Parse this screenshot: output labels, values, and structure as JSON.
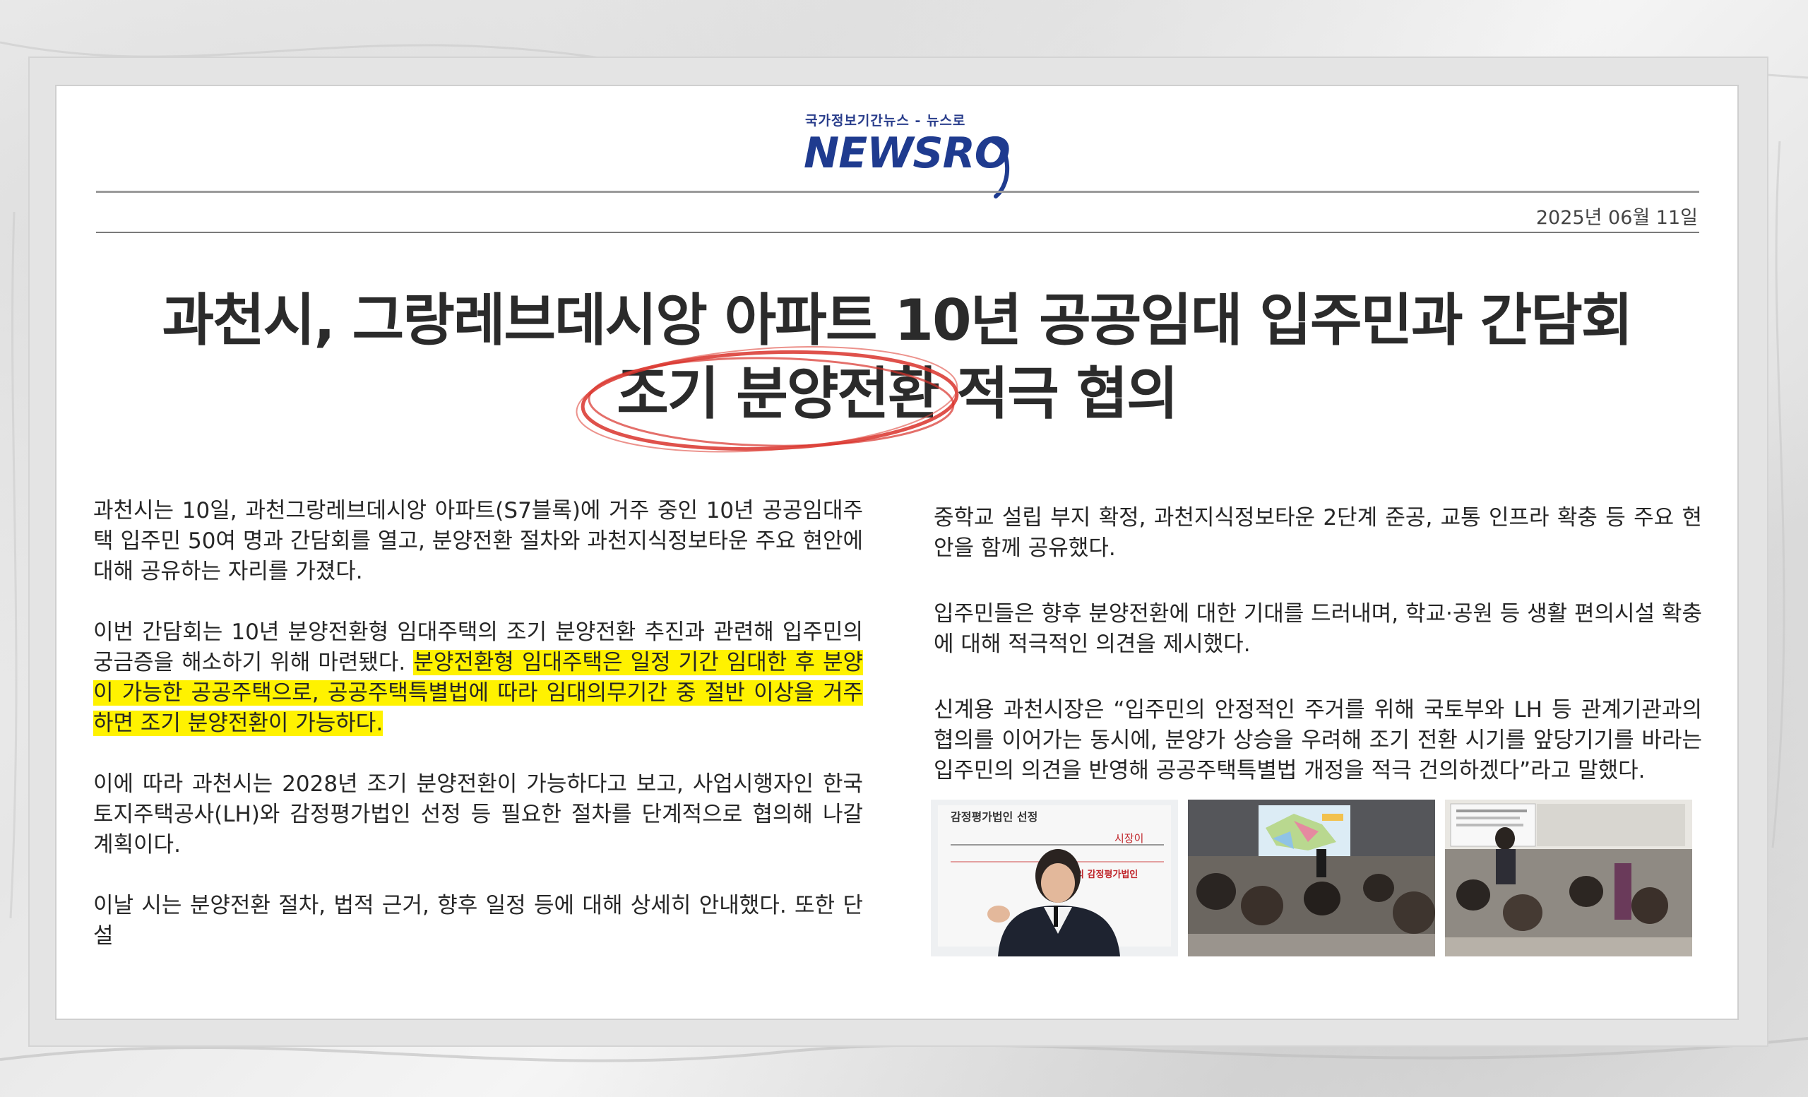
{
  "masthead": {
    "tagline": "국가정보기간뉴스 - 뉴스로",
    "logo_text": "NEWSRO"
  },
  "date": "2025년 06월 11일",
  "headline": {
    "line1": "과천시, 그랑레브데시앙 아파트 10년 공공임대 입주민과 간담회",
    "line2_circled": "조기 분양전환",
    "line2_rest": " 적극 협의"
  },
  "article": {
    "left": {
      "p1": "과천시는 10일, 과천그랑레브데시앙 아파트(S7블록)에 거주 중인 10년 공공임대주택 입주민 50여 명과 간담회를 열고, 분양전환 절차와 과천지식정보타운 주요 현안에 대해 공유하는 자리를 가졌다.",
      "p2_plain": "이번 간담회는 10년 분양전환형 임대주택의 조기 분양전환 추진과 관련해 입주민의 궁금증을 해소하기 위해 마련됐다. ",
      "p2_highlight": "분양전환형 임대주택은 일정 기간 임대한 후 분양이 가능한 공공주택으로, 공공주택특별법에 따라 임대의무기간 중 절반 이상을 거주하면 조기 분양전환이 가능하다.",
      "p3": "이에 따라 과천시는 2028년 조기 분양전환이 가능하다고 보고, 사업시행자인 한국토지주택공사(LH)와 감정평가법인 선정 등 필요한 절차를 단계적으로 협의해 나갈 계획이다.",
      "p4": "이날 시는 분양전환 절차, 법적 근거, 향후 일정 등에 대해 상세히 안내했다. 또한 단설"
    },
    "right": {
      "p1": "중학교 설립 부지 확정, 과천지식정보타운 2단계 준공, 교통 인프라 확충 등 주요 현안을 함께 공유했다.",
      "p2": "입주민들은 향후 분양전환에 대한 기대를 드러내며, 학교·공원 등 생활 편의시설 확충에 대해 적극적인 의견을 제시했다.",
      "p3": "신계용 과천시장은 “입주민의 안정적인 주거를 위해 국토부와 LH 등 관계기관과의 협의를 이어가는 동시에, 분양가 상승을 우려해 조기 전환 시기를 앞당기기를 바라는 입주민의 의견을 반영해 공공주택특별법 개정을 적극 건의하겠다”라고 말했다."
    }
  },
  "photos": {
    "photo1_slide_title": "감정평가법인 선정",
    "photo1_slide_line": "시장이",
    "photo1_slide_red": "의 감정평가법인"
  },
  "colors": {
    "logo_blue": "#1f3b8f",
    "highlight_yellow": "#fff200",
    "circle_red": "#d9322b",
    "headline_text": "#2b2b2b"
  }
}
